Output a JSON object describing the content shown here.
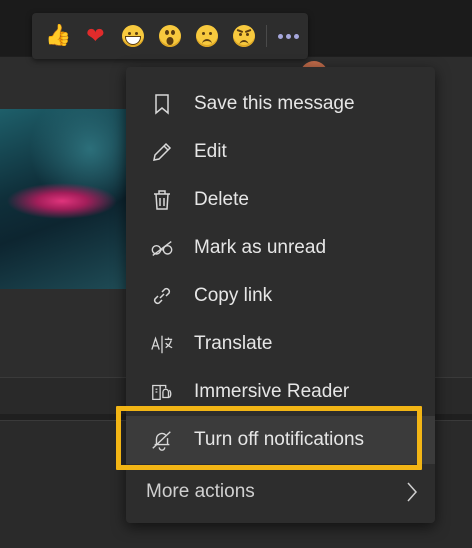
{
  "reactions": {
    "items": [
      {
        "name": "like",
        "glyph": "👍"
      },
      {
        "name": "heart",
        "glyph": "❤"
      },
      {
        "name": "laugh",
        "glyph": ""
      },
      {
        "name": "surprised",
        "glyph": ""
      },
      {
        "name": "sad",
        "glyph": ""
      },
      {
        "name": "angry",
        "glyph": ""
      }
    ],
    "accent": "#a6a7dc"
  },
  "menu": {
    "items": [
      {
        "label": "Save this message",
        "icon": "bookmark-icon"
      },
      {
        "label": "Edit",
        "icon": "pencil-icon"
      },
      {
        "label": "Delete",
        "icon": "trash-icon"
      },
      {
        "label": "Mark as unread",
        "icon": "unread-glasses-icon"
      },
      {
        "label": "Copy link",
        "icon": "link-icon"
      },
      {
        "label": "Translate",
        "icon": "translate-icon"
      },
      {
        "label": "Immersive Reader",
        "icon": "immersive-reader-icon"
      },
      {
        "label": "Turn off notifications",
        "icon": "bell-off-icon"
      }
    ],
    "more_actions_label": "More actions",
    "highlight_color": "#f2b515"
  }
}
